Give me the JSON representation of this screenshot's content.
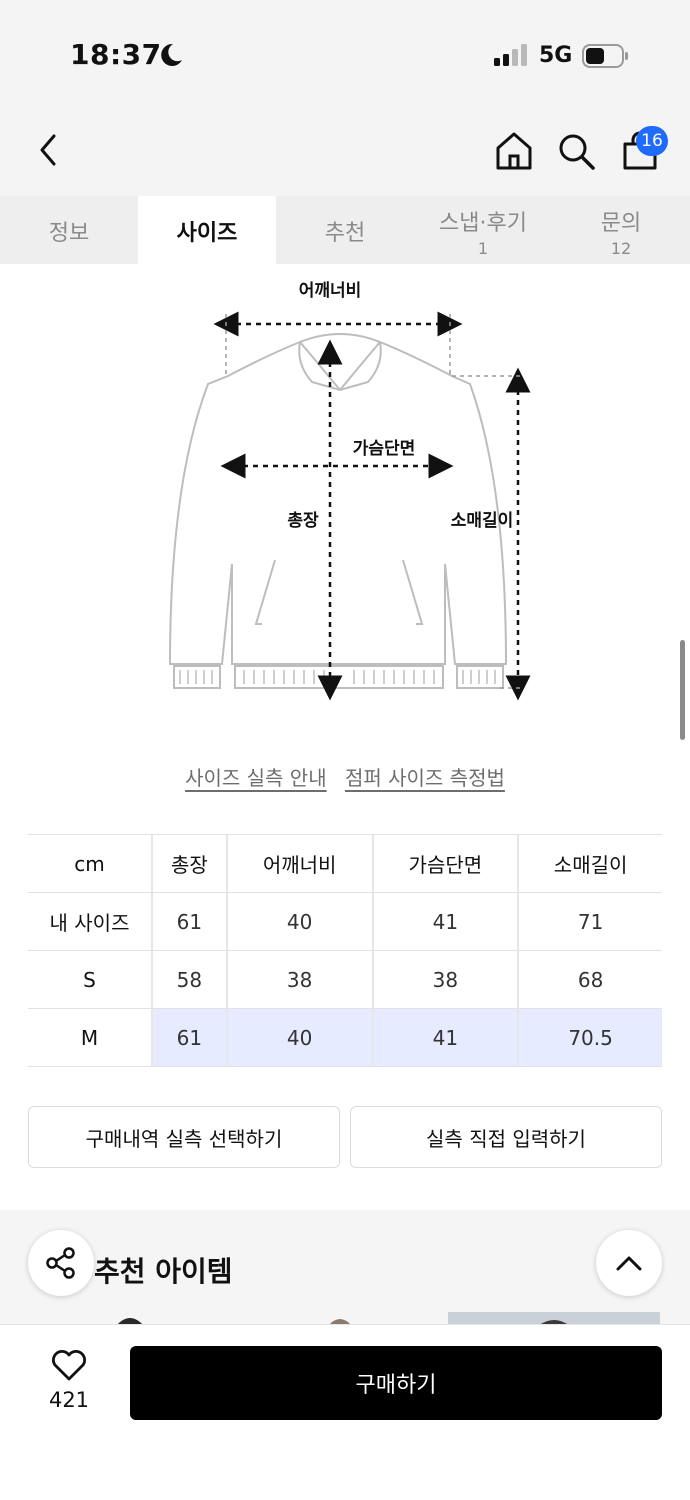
{
  "status_bar": {
    "time": "18:37",
    "network": "5G",
    "icons": [
      "moon-icon",
      "signal-icon",
      "battery-icon"
    ]
  },
  "nav": {
    "icons": [
      "back-icon",
      "home-icon",
      "search-icon",
      "shopping-bag-icon"
    ],
    "cart_badge": "16",
    "badge_color": "#1f6bff"
  },
  "tabs": [
    {
      "label": "정보",
      "count": ""
    },
    {
      "label": "사이즈",
      "count": "",
      "active": true
    },
    {
      "label": "추천",
      "count": ""
    },
    {
      "label": "스냅·후기",
      "count": "1"
    },
    {
      "label": "문의",
      "count": "12"
    }
  ],
  "diagram": {
    "shoulder": "어깨너비",
    "chest": "가슴단면",
    "length": "총장",
    "sleeve": "소매길이"
  },
  "guide_links": {
    "actual_size": "사이즈 실측 안내",
    "measure_method": "점퍼 사이즈 측정법"
  },
  "size_table": {
    "unit": "cm",
    "columns": [
      "총장",
      "어깨너비",
      "가슴단면",
      "소매길이"
    ],
    "rows": [
      {
        "label": "내 사이즈",
        "values": [
          "61",
          "40",
          "41",
          "71"
        ]
      },
      {
        "label": "S",
        "values": [
          "58",
          "38",
          "38",
          "68"
        ]
      },
      {
        "label": "M",
        "values": [
          "61",
          "40",
          "41",
          "70.5"
        ],
        "highlighted": true
      }
    ],
    "highlight_color": "#e6ebff"
  },
  "actions": {
    "select_from_history": "구매내역 실측 선택하기",
    "enter_manually": "실측 직접 입력하기"
  },
  "recommend": {
    "title": "추천 아이템"
  },
  "bottom_bar": {
    "like_count": "421",
    "buy_label": "구매하기"
  }
}
